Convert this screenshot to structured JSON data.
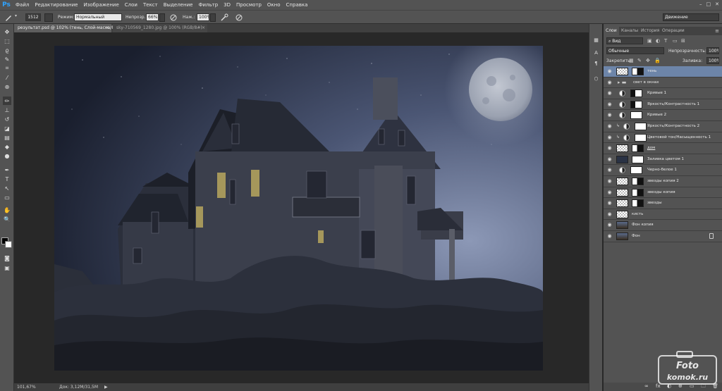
{
  "app": {
    "logo": "Ps"
  },
  "menu": [
    "Файл",
    "Редактирование",
    "Изображение",
    "Слои",
    "Текст",
    "Выделение",
    "Фильтр",
    "3D",
    "Просмотр",
    "Окно",
    "Справка"
  ],
  "window_buttons": [
    "–",
    "□",
    "✕"
  ],
  "options": {
    "brush_size": "1512",
    "mode_label": "Режим:",
    "mode_value": "Нормальный",
    "opacity_label": "Непрозр.:",
    "opacity_value": "66%",
    "flow_label": "Наж.:",
    "flow_value": "100%",
    "workspace": "Движение"
  },
  "doc_tabs": [
    {
      "label": "результат.psd @ 102% (тень, Слой-маска/8)",
      "close": "×"
    },
    {
      "label": "sky-710569_1280.jpg @ 100% (RGB/8#)",
      "close": "×"
    }
  ],
  "status": {
    "zoom": "101,67%",
    "doc": "Док: 3,12M/31,5M",
    "arrow": "▶"
  },
  "layers_panel": {
    "tabs": [
      "Слои",
      "Каналы",
      "История",
      "Операции"
    ],
    "kind_label": "Вид",
    "blend_mode": "Обычные",
    "opacity_label": "Непрозрачность:",
    "opacity_value": "100%",
    "lock_label": "Закрепить:",
    "fill_label": "Заливка:",
    "fill_value": "100%",
    "layers": [
      {
        "name": "тень",
        "selected": true,
        "type": "pixel-mask"
      },
      {
        "name": "свет в окнах",
        "selected": false,
        "type": "group"
      },
      {
        "name": "Кривые 1",
        "selected": false,
        "type": "adjustment"
      },
      {
        "name": "Яркость/Контрастность 1",
        "selected": false,
        "type": "adjustment"
      },
      {
        "name": "Кривые 2",
        "selected": false,
        "type": "adjustment"
      },
      {
        "name": "Яркость/Контрастность 2",
        "selected": false,
        "type": "adjustment-clipped"
      },
      {
        "name": "Цветовой тон/Насыщенность 1",
        "selected": false,
        "type": "adjustment-clipped"
      },
      {
        "name": "дом",
        "selected": false,
        "type": "pixel-mask"
      },
      {
        "name": "Заливка цветом 1",
        "selected": false,
        "type": "fill"
      },
      {
        "name": "Черно-белое 1",
        "selected": false,
        "type": "adjustment"
      },
      {
        "name": "звезды копия 2",
        "selected": false,
        "type": "pixel-mask"
      },
      {
        "name": "звезды копия",
        "selected": false,
        "type": "pixel-mask"
      },
      {
        "name": "звезды",
        "selected": false,
        "type": "pixel-mask"
      },
      {
        "name": "кисть",
        "selected": false,
        "type": "pixel"
      },
      {
        "name": "Фон копия",
        "selected": false,
        "type": "photo"
      },
      {
        "name": "Фон",
        "selected": false,
        "type": "photo-locked"
      }
    ],
    "bottom_icons": [
      "∞",
      "fx",
      "◐",
      "⊕",
      "▭",
      "🗀",
      "🗑"
    ]
  },
  "watermark": {
    "line1": "Foto",
    "line2": "komok.ru"
  },
  "colors": {
    "ui_bg": "#535353",
    "dark_bg": "#282828",
    "selected_layer": "#6d85a9",
    "ps_blue": "#2fa3ff"
  }
}
